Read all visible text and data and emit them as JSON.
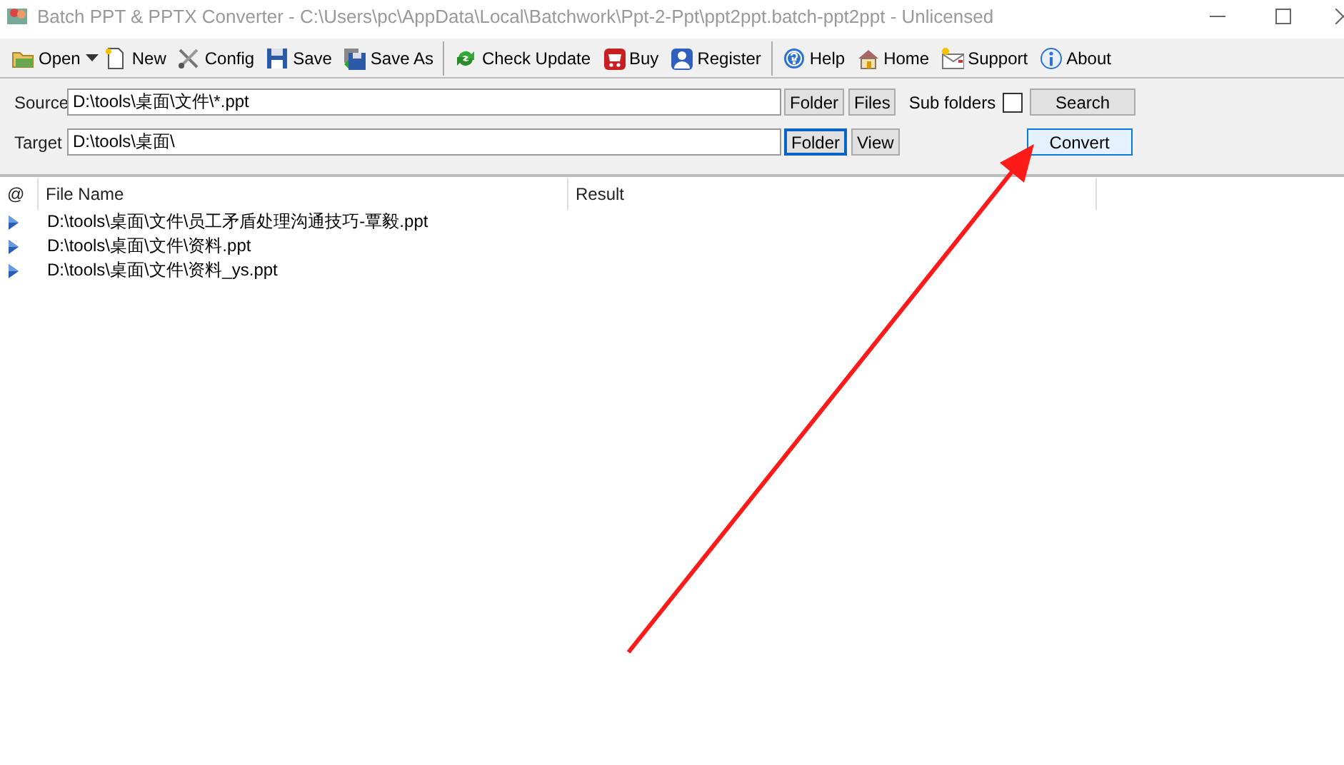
{
  "window": {
    "title": "Batch PPT & PPTX Converter - C:\\Users\\pc\\AppData\\Local\\Batchwork\\Ppt-2-Ppt\\ppt2ppt.batch-ppt2ppt - Unlicensed"
  },
  "toolbar": {
    "groups": [
      [
        {
          "kind": "folder",
          "label": "Open"
        },
        {
          "kind": "dropdown"
        },
        {
          "kind": "document",
          "label": "New"
        },
        {
          "kind": "tools",
          "label": "Config"
        },
        {
          "kind": "floppy",
          "label": "Save"
        },
        {
          "kind": "floppy-multi",
          "label": "Save As"
        }
      ],
      [
        {
          "kind": "refresh",
          "label": "Check Update"
        },
        {
          "kind": "cart",
          "label": "Buy"
        },
        {
          "kind": "user",
          "label": "Register"
        }
      ],
      [
        {
          "kind": "help",
          "label": "Help"
        },
        {
          "kind": "house",
          "label": "Home"
        },
        {
          "kind": "envelope",
          "label": "Support"
        },
        {
          "kind": "info",
          "label": "About"
        }
      ]
    ]
  },
  "source": {
    "label": "Source",
    "value": "D:\\tools\\桌面\\文件\\*.ppt",
    "buttons": [
      {
        "label": "Folder",
        "focused": false
      },
      {
        "label": "Files",
        "focused": false
      }
    ],
    "subfolders": {
      "label": "Sub folders",
      "checked": false
    },
    "action": {
      "label": "Search",
      "highlighted": false
    }
  },
  "target": {
    "label": "Target",
    "value": "D:\\tools\\桌面\\",
    "buttons": [
      {
        "label": "Folder",
        "focused": true
      },
      {
        "label": "View",
        "focused": false
      }
    ],
    "action": {
      "label": "Convert",
      "highlighted": true
    }
  },
  "table": {
    "columns": [
      "@",
      "File Name",
      "Result"
    ],
    "rows": [
      {
        "file": "D:\\tools\\桌面\\文件\\员工矛盾处理沟通技巧-覃毅.ppt",
        "expanded": false
      },
      {
        "file": "D:\\tools\\桌面\\文件\\资料.ppt",
        "expanded": false
      },
      {
        "file": "D:\\tools\\桌面\\文件\\资料_ys.ppt",
        "expanded": false
      }
    ]
  },
  "annotation": {
    "kind": "arrow"
  }
}
